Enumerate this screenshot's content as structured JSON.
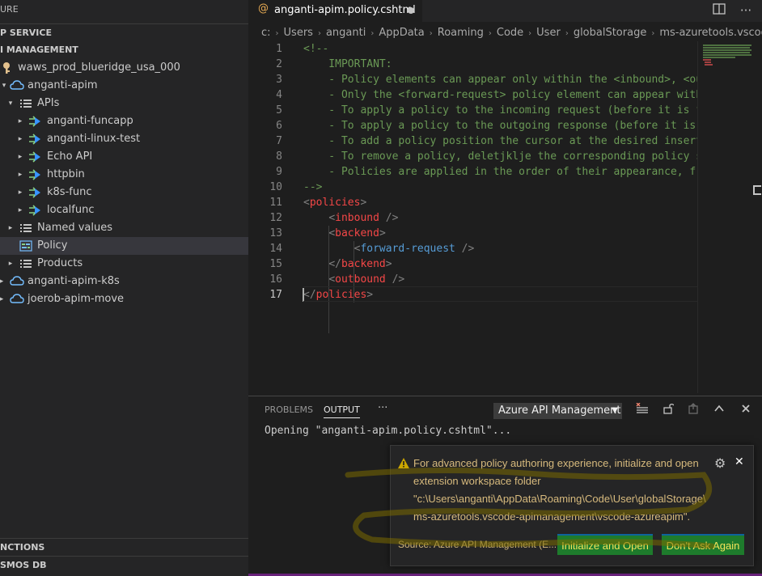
{
  "sidebar": {
    "title": "URE",
    "sections": {
      "app_service": "P SERVICE",
      "api_management": "I MANAGEMENT",
      "functions": "NCTIONS",
      "cosmos": "SMOS DB"
    },
    "tree": [
      {
        "label": "waws_prod_blueridge_usa_000",
        "icon": "key-icon",
        "twistie": ""
      },
      {
        "label": "anganti-apim",
        "icon": "cloud-icon",
        "twistie": "▾"
      },
      {
        "label": "APIs",
        "icon": "list-icon",
        "twistie": "▾"
      },
      {
        "label": "anganti-funcapp",
        "icon": "api-icon",
        "twistie": "▸"
      },
      {
        "label": "anganti-linux-test",
        "icon": "api-icon",
        "twistie": "▸"
      },
      {
        "label": "Echo API",
        "icon": "api-icon",
        "twistie": "▸"
      },
      {
        "label": "httpbin",
        "icon": "api-icon",
        "twistie": "▸"
      },
      {
        "label": "k8s-func",
        "icon": "api-icon",
        "twistie": "▸"
      },
      {
        "label": "localfunc",
        "icon": "api-icon",
        "twistie": "▸"
      },
      {
        "label": "Named values",
        "icon": "list-icon",
        "twistie": "▸"
      },
      {
        "label": "Policy",
        "icon": "policy-icon",
        "twistie": ""
      },
      {
        "label": "Products",
        "icon": "list-icon",
        "twistie": "▸"
      },
      {
        "label": "anganti-apim-k8s",
        "icon": "cloud-icon",
        "twistie": "▸"
      },
      {
        "label": "joerob-apim-move",
        "icon": "cloud-icon",
        "twistie": "▸"
      }
    ]
  },
  "editor": {
    "tab": {
      "icon": "@",
      "name": "anganti-apim.policy.cshtml"
    },
    "breadcrumbs": [
      "c:",
      "Users",
      "anganti",
      "AppData",
      "Roaming",
      "Code",
      "User",
      "globalStorage",
      "ms-azuretools.vscode-apimar"
    ],
    "lines": [
      {
        "n": "1",
        "t": "<!--"
      },
      {
        "n": "2",
        "t": "    IMPORTANT:"
      },
      {
        "n": "3",
        "t": "    - Policy elements can appear only within the <inbound>, <out"
      },
      {
        "n": "4",
        "t": "    - Only the <forward-request> policy element can appear withi"
      },
      {
        "n": "5",
        "t": "    - To apply a policy to the incoming request (before it is fo"
      },
      {
        "n": "6",
        "t": "    - To apply a policy to the outgoing response (before it is s"
      },
      {
        "n": "7",
        "t": "    - To add a policy position the cursor at the desired inserti"
      },
      {
        "n": "8",
        "t": "    - To remove a policy, deletjklje the corresponding policy st"
      },
      {
        "n": "9",
        "t": "    - Policies are applied in the order of their appearance, fro"
      },
      {
        "n": "10",
        "t": "-->"
      },
      {
        "n": "11",
        "t": "<policies>"
      },
      {
        "n": "12",
        "t": "    <inbound />"
      },
      {
        "n": "13",
        "t": "    <backend>"
      },
      {
        "n": "14",
        "t": "        <forward-request />"
      },
      {
        "n": "15",
        "t": "    </backend>"
      },
      {
        "n": "16",
        "t": "    <outbound />"
      },
      {
        "n": "17",
        "t": "</policies>"
      }
    ]
  },
  "panel": {
    "tabs": [
      "PROBLEMS",
      "OUTPUT",
      "···"
    ],
    "active_tab": "OUTPUT",
    "output_channel": "Azure API Management",
    "output_text": "Opening \"anganti-apim.policy.cshtml\"..."
  },
  "notification": {
    "message_line1": "For advanced policy authoring experience, initialize and open",
    "message_line2": "extension workspace folder",
    "message_line3": "\"c:\\Users\\anganti\\AppData\\Roaming\\Code\\User\\globalStorage\\",
    "message_line4": "ms-azuretools.vscode-apimanagement\\vscode-azureapim\".",
    "source": "Source: Azure API Management (E...",
    "primary_button": "Initialize and Open",
    "secondary_button": "Don't Ask Again"
  },
  "colors": {
    "accent_status": "#68217a",
    "button_bg": "#1e7b2c",
    "button_text": "#f5e45a",
    "warning": "#d7ba7d"
  }
}
